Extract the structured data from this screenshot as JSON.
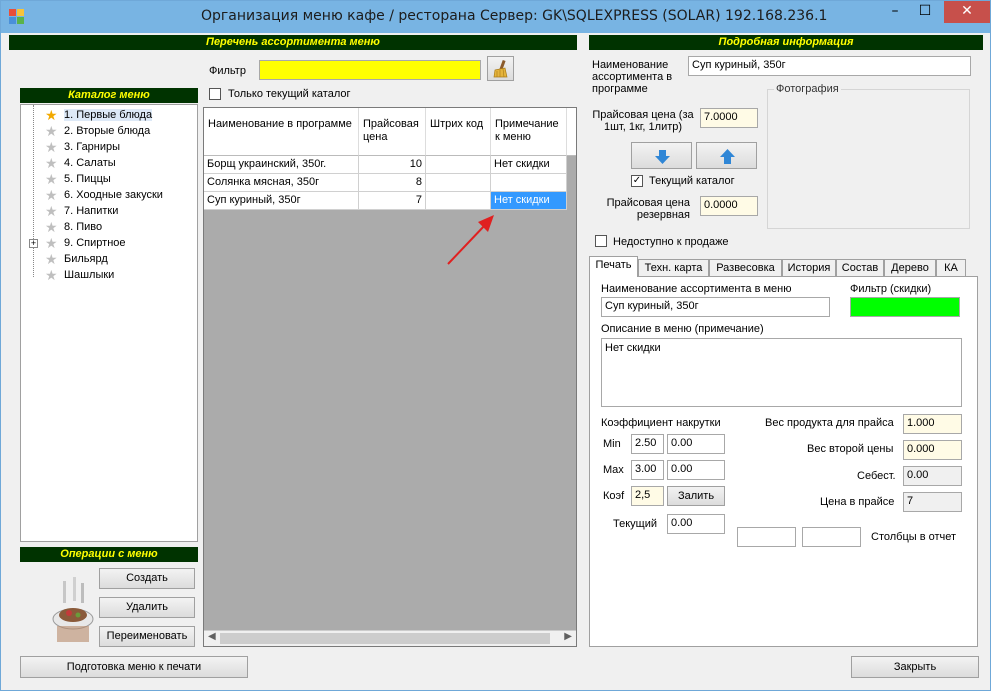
{
  "window": {
    "title": "Организация меню кафе / ресторана  Сервер: GK\\SQLEXPRESS (SOLAR) 192.168.236.1",
    "minimize": "–",
    "maximize": "☐",
    "close": "✕"
  },
  "left_panel": {
    "header": "Перечень ассортимента меню",
    "filter_label": "Фильтр",
    "filter_value": "",
    "only_current_label": "Только текущий каталог",
    "only_current_checked": false
  },
  "catalog": {
    "header": "Каталог меню",
    "items": [
      {
        "label": "1. Первые блюда",
        "selected": true
      },
      {
        "label": "2. Вторые блюда"
      },
      {
        "label": "3. Гарниры"
      },
      {
        "label": "4. Салаты"
      },
      {
        "label": "5. Пиццы"
      },
      {
        "label": "6. Хоодные закуски"
      },
      {
        "label": "7. Напитки"
      },
      {
        "label": "8. Пиво"
      },
      {
        "label": "9. Спиртное",
        "expandable": true
      },
      {
        "label": "Бильярд"
      },
      {
        "label": "Шашлыки"
      }
    ]
  },
  "operations": {
    "header": "Операции с меню",
    "create": "Создать",
    "delete": "Удалить",
    "rename": "Переименовать"
  },
  "grid": {
    "columns": [
      "Наименование в программе",
      "Прайсовая цена",
      "Штрих код",
      "Примечание к меню"
    ],
    "rows": [
      {
        "name": "Борщ украинский, 350г.",
        "price": "10",
        "barcode": "",
        "note": "Нет скидки"
      },
      {
        "name": "Солянка мясная, 350г",
        "price": "8",
        "barcode": "",
        "note": ""
      },
      {
        "name": "Суп куриный, 350г",
        "price": "7",
        "barcode": "",
        "note": "Нет скидки"
      }
    ]
  },
  "details": {
    "header": "Подробная информация",
    "name_label": "Наименование ассортимента в программе",
    "name_value": "Суп куриный, 350г",
    "price_label": "Прайсовая цена (за 1шт, 1кг, 1литр)",
    "price_value": "7.0000",
    "photo_label": "Фотография",
    "current_catalog_label": "Текущий каталог",
    "current_catalog_checked": true,
    "reserve_price_label": "Прайсовая цена резервная",
    "reserve_price_value": "0.0000",
    "unavailable_label": "Недоступно к продаже",
    "unavailable_checked": false
  },
  "tabs": [
    "Печать",
    "Техн. карта",
    "Развесовка",
    "История",
    "Состав",
    "Дерево",
    "КА"
  ],
  "print_tab": {
    "menu_name_label": "Наименование ассортимента в меню",
    "menu_name_value": "Суп куриный, 350г",
    "filter_label": "Фильтр (скидки)",
    "description_label": "Описание в меню (примечание)",
    "description_value": "Нет скидки",
    "markup_label": "Коэффициент накрутки",
    "min_label": "Min",
    "min_value": "2.50",
    "min_value2": "0.00",
    "max_label": "Max",
    "max_value": "3.00",
    "max_value2": "0.00",
    "koef_label": "Коэf",
    "koef_value": "2,5",
    "fill_button": "Залить",
    "current_label": "Текущий",
    "current_value": "0.00",
    "weight_label": "Вес продукта для прайса",
    "weight_value": "1.000",
    "second_weight_label": "Вес второй цены",
    "second_weight_value": "0.000",
    "cost_label": "Себест.",
    "cost_value": "0.00",
    "price_label": "Цена в прайсе",
    "price_value": "7",
    "columns_label": "Столбцы в отчет"
  },
  "footer": {
    "prepare_button": "Подготовка меню к печати",
    "close_button": "Закрыть"
  },
  "colors": {
    "header_bg": "#003300",
    "header_text": "#ffff00",
    "filter_bg": "#ffff00",
    "discount_filter_bg": "#00ff00",
    "selection": "#3399ff",
    "title_bar": "#78b4e3",
    "close_button": "#c7504b"
  }
}
